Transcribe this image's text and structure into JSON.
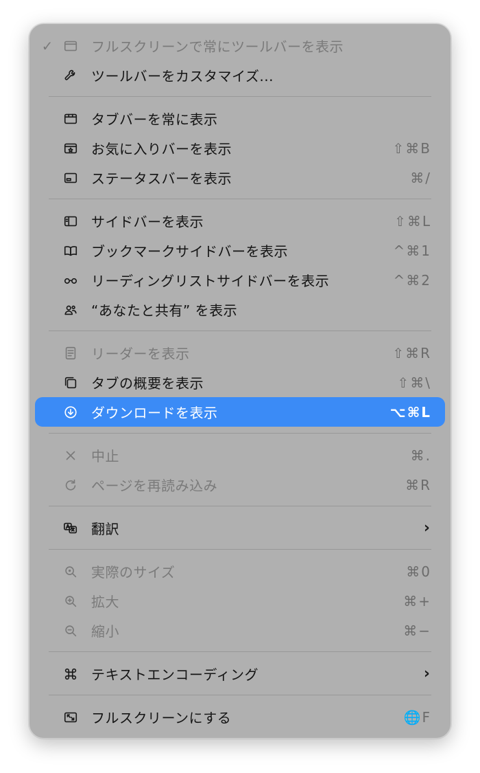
{
  "menu": {
    "items": [
      {
        "type": "item",
        "name": "always-show-toolbar-fullscreen",
        "checked": true,
        "disabled": true,
        "icon": "window-icon",
        "label": "フルスクリーンで常にツールバーを表示",
        "shortcut": ""
      },
      {
        "type": "item",
        "name": "customize-toolbar",
        "disabled": false,
        "icon": "wrench-icon",
        "label": "ツールバーをカスタマイズ...",
        "shortcut": ""
      },
      {
        "type": "sep"
      },
      {
        "type": "item",
        "name": "always-show-tab-bar",
        "disabled": false,
        "icon": "tabbar-icon",
        "label": "タブバーを常に表示",
        "shortcut": ""
      },
      {
        "type": "item",
        "name": "show-favorites-bar",
        "disabled": false,
        "icon": "favorites-bar-icon",
        "label": "お気に入りバーを表示",
        "shortcut": "⇧⌘B"
      },
      {
        "type": "item",
        "name": "show-status-bar",
        "disabled": false,
        "icon": "status-bar-icon",
        "label": "ステータスバーを表示",
        "shortcut": "⌘/"
      },
      {
        "type": "sep"
      },
      {
        "type": "item",
        "name": "show-sidebar",
        "disabled": false,
        "icon": "sidebar-icon",
        "label": "サイドバーを表示",
        "shortcut": "⇧⌘L"
      },
      {
        "type": "item",
        "name": "show-bookmarks-sidebar",
        "disabled": false,
        "icon": "book-icon",
        "label": "ブックマークサイドバーを表示",
        "shortcut": "^⌘1"
      },
      {
        "type": "item",
        "name": "show-reading-list-sidebar",
        "disabled": false,
        "icon": "glasses-icon",
        "label": "リーディングリストサイドバーを表示",
        "shortcut": "^⌘2"
      },
      {
        "type": "item",
        "name": "show-shared-with-you",
        "disabled": false,
        "icon": "shared-people-icon",
        "label": "“あなたと共有” を表示",
        "shortcut": ""
      },
      {
        "type": "sep"
      },
      {
        "type": "item",
        "name": "show-reader",
        "disabled": true,
        "icon": "reader-icon",
        "label": "リーダーを表示",
        "shortcut": "⇧⌘R"
      },
      {
        "type": "item",
        "name": "show-tab-overview",
        "disabled": false,
        "icon": "tab-overview-icon",
        "label": "タブの概要を表示",
        "shortcut": "⇧⌘\\"
      },
      {
        "type": "item",
        "name": "show-downloads",
        "disabled": false,
        "selected": true,
        "icon": "download-icon",
        "label": "ダウンロードを表示",
        "shortcut": "⌥⌘L"
      },
      {
        "type": "sep"
      },
      {
        "type": "item",
        "name": "stop",
        "disabled": true,
        "icon": "close-icon",
        "label": "中止",
        "shortcut": "⌘."
      },
      {
        "type": "item",
        "name": "reload-page",
        "disabled": true,
        "icon": "reload-icon",
        "label": "ページを再読み込み",
        "shortcut": "⌘R"
      },
      {
        "type": "sep"
      },
      {
        "type": "item",
        "name": "translate",
        "disabled": false,
        "icon": "translate-icon",
        "label": "翻訳",
        "submenu": true
      },
      {
        "type": "sep"
      },
      {
        "type": "item",
        "name": "actual-size",
        "disabled": true,
        "icon": "zoom-icon",
        "label": "実際のサイズ",
        "shortcut": "⌘0"
      },
      {
        "type": "item",
        "name": "zoom-in",
        "disabled": true,
        "icon": "zoom-in-icon",
        "label": "拡大",
        "shortcut": "⌘+"
      },
      {
        "type": "item",
        "name": "zoom-out",
        "disabled": true,
        "icon": "zoom-out-icon",
        "label": "縮小",
        "shortcut": "⌘−"
      },
      {
        "type": "sep"
      },
      {
        "type": "item",
        "name": "text-encoding",
        "disabled": false,
        "icon": "command-icon",
        "label": "テキストエンコーディング",
        "submenu": true
      },
      {
        "type": "sep"
      },
      {
        "type": "item",
        "name": "enter-fullscreen",
        "disabled": false,
        "icon": "fullscreen-icon",
        "label": "フルスクリーンにする",
        "shortcut": "🌐F"
      }
    ]
  },
  "check_mark": "✓",
  "submenu_arrow": "›",
  "colors": {
    "menu_background": "#b0b0b0",
    "selection": "#3b8bf6",
    "text": "#141414",
    "disabled_text": "#7a7a7a"
  }
}
